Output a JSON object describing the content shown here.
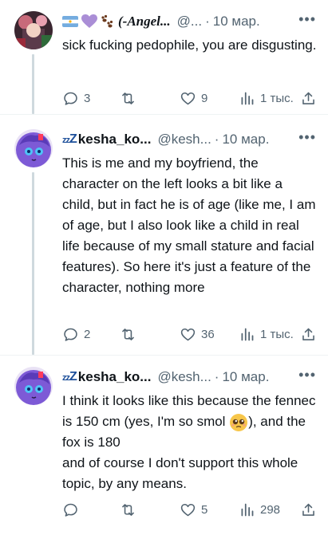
{
  "tweets": [
    {
      "name": "(-Angel...",
      "handle": "@...",
      "dot": "·",
      "date": "10 мар.",
      "more": "•••",
      "text": "sick fucking pedophile, you are disgusting.",
      "replies": "3",
      "retweets": "",
      "likes": "9",
      "views": "1 тыс."
    },
    {
      "zzz_small": "zz",
      "zzz_big": "Z",
      "name": "kesha_ko...",
      "handle": "@kesh...",
      "dot": "·",
      "date": "10 мар.",
      "more": "•••",
      "text": "This is me and my boyfriend, the character on the left looks a bit like a child, but in fact he is of age (like me, I am of age, but I also look like a child in real life because of my small stature and facial features). So here it's just a feature of the character, nothing more",
      "replies": "2",
      "retweets": "",
      "likes": "36",
      "views": "1 тыс."
    },
    {
      "zzz_small": "zz",
      "zzz_big": "Z",
      "name": "kesha_ko...",
      "handle": "@kesh...",
      "dot": "·",
      "date": "10 мар.",
      "more": "•••",
      "text_part1": "I think it looks like this because the fennec is 150 cm (yes, I'm so smol ",
      "text_part2": "), and the fox is 180",
      "text_part3": "and of course I don't support this whole topic, by any means.",
      "replies": "",
      "retweets": "",
      "likes": "5",
      "views": "298"
    }
  ],
  "colors": {
    "text": "#0f1419",
    "secondary": "#536471",
    "thread_line": "#cfd9de"
  },
  "icons": [
    "reply-icon",
    "retweet-icon",
    "like-icon",
    "views-icon",
    "share-icon",
    "more-icon"
  ]
}
